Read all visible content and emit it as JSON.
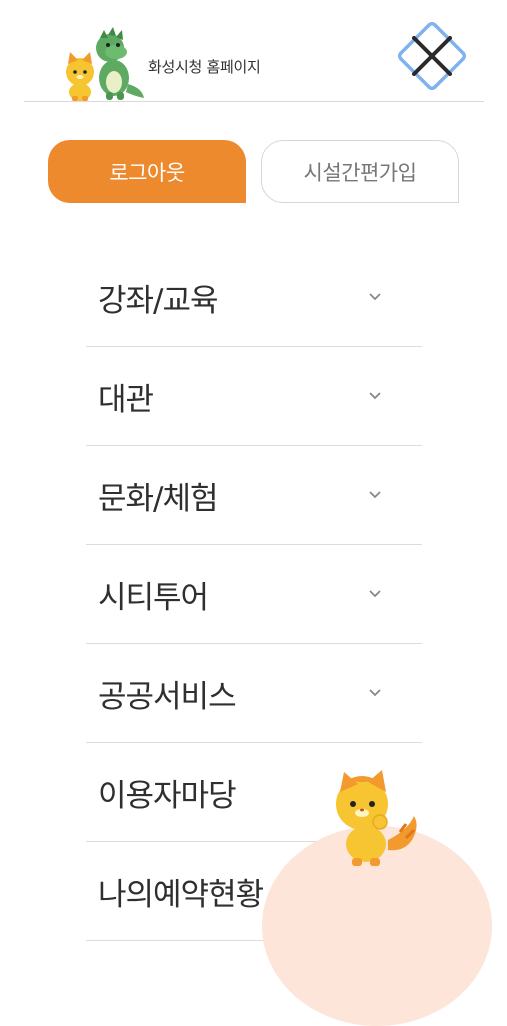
{
  "header": {
    "title": "화성시청 홈페이지",
    "close_icon": "close-icon"
  },
  "auth": {
    "logout_label": "로그아웃",
    "signup_label": "시설간편가입",
    "accent_color": "#ee8a2e"
  },
  "menu": {
    "items": [
      {
        "label": "강좌/교육",
        "icon": "chevron-down-icon"
      },
      {
        "label": "대관",
        "icon": "chevron-down-icon"
      },
      {
        "label": "문화/체험",
        "icon": "chevron-down-icon"
      },
      {
        "label": "시티투어",
        "icon": "chevron-down-icon"
      },
      {
        "label": "공공서비스",
        "icon": "chevron-down-icon"
      },
      {
        "label": "이용자마당",
        "icon": "chevron-down-icon"
      },
      {
        "label": "나의예약현황",
        "icon": "chevron-down-icon"
      }
    ]
  }
}
